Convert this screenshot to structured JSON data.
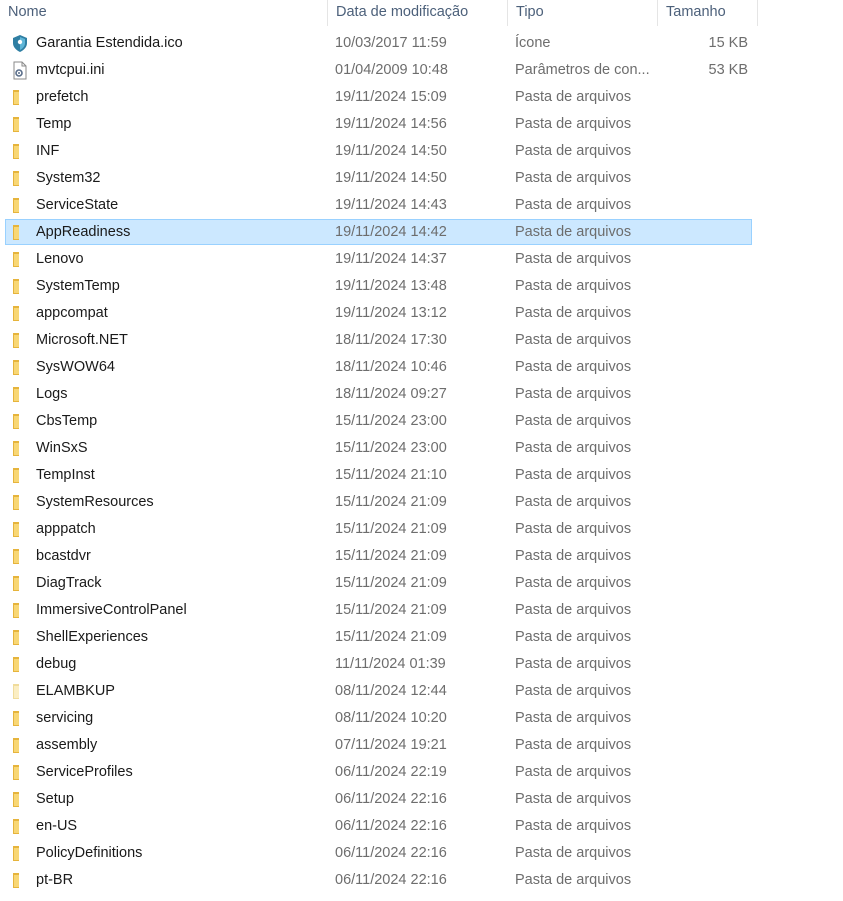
{
  "columns": {
    "name": "Nome",
    "date": "Data de modificação",
    "type": "Tipo",
    "size": "Tamanho"
  },
  "colors": {
    "folder": "#f8d775",
    "folder_dark": "#e6b43c",
    "selection": "#cce8ff",
    "selection_border": "#99d1ff"
  },
  "rows": [
    {
      "name": "Garantia Estendida.ico",
      "date": "10/03/2017 11:59",
      "type": "Ícone",
      "size": "15 KB",
      "icon": "shield-icon"
    },
    {
      "name": "mvtcpui.ini",
      "date": "01/04/2009 10:48",
      "type": "Parâmetros de con...",
      "size": "53 KB",
      "icon": "settings-file-icon"
    },
    {
      "name": "prefetch",
      "date": "19/11/2024 15:09",
      "type": "Pasta de arquivos",
      "size": "",
      "icon": "folder-icon"
    },
    {
      "name": "Temp",
      "date": "19/11/2024 14:56",
      "type": "Pasta de arquivos",
      "size": "",
      "icon": "folder-icon"
    },
    {
      "name": "INF",
      "date": "19/11/2024 14:50",
      "type": "Pasta de arquivos",
      "size": "",
      "icon": "folder-icon"
    },
    {
      "name": "System32",
      "date": "19/11/2024 14:50",
      "type": "Pasta de arquivos",
      "size": "",
      "icon": "folder-icon"
    },
    {
      "name": "ServiceState",
      "date": "19/11/2024 14:43",
      "type": "Pasta de arquivos",
      "size": "",
      "icon": "folder-icon"
    },
    {
      "name": "AppReadiness",
      "date": "19/11/2024 14:42",
      "type": "Pasta de arquivos",
      "size": "",
      "icon": "folder-icon",
      "selected": true
    },
    {
      "name": "Lenovo",
      "date": "19/11/2024 14:37",
      "type": "Pasta de arquivos",
      "size": "",
      "icon": "folder-icon"
    },
    {
      "name": "SystemTemp",
      "date": "19/11/2024 13:48",
      "type": "Pasta de arquivos",
      "size": "",
      "icon": "folder-icon"
    },
    {
      "name": "appcompat",
      "date": "19/11/2024 13:12",
      "type": "Pasta de arquivos",
      "size": "",
      "icon": "folder-icon"
    },
    {
      "name": "Microsoft.NET",
      "date": "18/11/2024 17:30",
      "type": "Pasta de arquivos",
      "size": "",
      "icon": "folder-icon"
    },
    {
      "name": "SysWOW64",
      "date": "18/11/2024 10:46",
      "type": "Pasta de arquivos",
      "size": "",
      "icon": "folder-icon"
    },
    {
      "name": "Logs",
      "date": "18/11/2024 09:27",
      "type": "Pasta de arquivos",
      "size": "",
      "icon": "folder-icon"
    },
    {
      "name": "CbsTemp",
      "date": "15/11/2024 23:00",
      "type": "Pasta de arquivos",
      "size": "",
      "icon": "folder-icon"
    },
    {
      "name": "WinSxS",
      "date": "15/11/2024 23:00",
      "type": "Pasta de arquivos",
      "size": "",
      "icon": "folder-icon"
    },
    {
      "name": "TempInst",
      "date": "15/11/2024 21:10",
      "type": "Pasta de arquivos",
      "size": "",
      "icon": "folder-icon"
    },
    {
      "name": "SystemResources",
      "date": "15/11/2024 21:09",
      "type": "Pasta de arquivos",
      "size": "",
      "icon": "folder-icon"
    },
    {
      "name": "apppatch",
      "date": "15/11/2024 21:09",
      "type": "Pasta de arquivos",
      "size": "",
      "icon": "folder-icon"
    },
    {
      "name": "bcastdvr",
      "date": "15/11/2024 21:09",
      "type": "Pasta de arquivos",
      "size": "",
      "icon": "folder-icon"
    },
    {
      "name": "DiagTrack",
      "date": "15/11/2024 21:09",
      "type": "Pasta de arquivos",
      "size": "",
      "icon": "folder-icon"
    },
    {
      "name": "ImmersiveControlPanel",
      "date": "15/11/2024 21:09",
      "type": "Pasta de arquivos",
      "size": "",
      "icon": "folder-icon"
    },
    {
      "name": "ShellExperiences",
      "date": "15/11/2024 21:09",
      "type": "Pasta de arquivos",
      "size": "",
      "icon": "folder-icon"
    },
    {
      "name": "debug",
      "date": "11/11/2024 01:39",
      "type": "Pasta de arquivos",
      "size": "",
      "icon": "folder-icon"
    },
    {
      "name": "ELAMBKUP",
      "date": "08/11/2024 12:44",
      "type": "Pasta de arquivos",
      "size": "",
      "icon": "hidden-folder-icon"
    },
    {
      "name": "servicing",
      "date": "08/11/2024 10:20",
      "type": "Pasta de arquivos",
      "size": "",
      "icon": "folder-icon"
    },
    {
      "name": "assembly",
      "date": "07/11/2024 19:21",
      "type": "Pasta de arquivos",
      "size": "",
      "icon": "folder-icon"
    },
    {
      "name": "ServiceProfiles",
      "date": "06/11/2024 22:19",
      "type": "Pasta de arquivos",
      "size": "",
      "icon": "folder-icon"
    },
    {
      "name": "Setup",
      "date": "06/11/2024 22:16",
      "type": "Pasta de arquivos",
      "size": "",
      "icon": "folder-icon"
    },
    {
      "name": "en-US",
      "date": "06/11/2024 22:16",
      "type": "Pasta de arquivos",
      "size": "",
      "icon": "folder-icon"
    },
    {
      "name": "PolicyDefinitions",
      "date": "06/11/2024 22:16",
      "type": "Pasta de arquivos",
      "size": "",
      "icon": "folder-icon"
    },
    {
      "name": "pt-BR",
      "date": "06/11/2024 22:16",
      "type": "Pasta de arquivos",
      "size": "",
      "icon": "folder-icon"
    }
  ]
}
